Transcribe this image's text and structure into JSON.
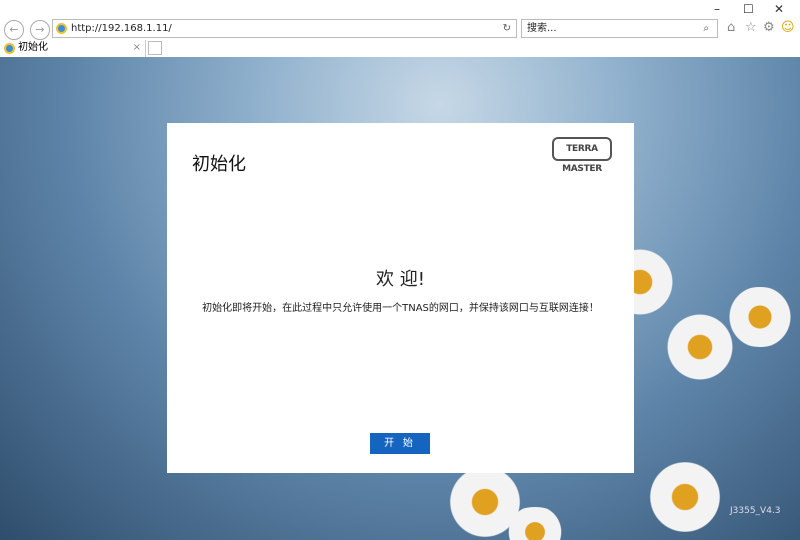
{
  "browser": {
    "url": "http://192.168.1.11/",
    "search_placeholder": "搜索...",
    "tab_title": "初始化",
    "tab_close": "×",
    "minimize": "–",
    "maximize": "☐",
    "close": "✕",
    "back": "←",
    "forward": "→",
    "refresh": "↻",
    "search_btn": "⌕",
    "home": "⌂",
    "favorites": "☆",
    "settings": "⚙",
    "feedback": "☺"
  },
  "dialog": {
    "title": "初始化",
    "logo": "TERRA MASTER",
    "welcome": "欢 迎!",
    "message": "初始化即将开始，在此过程中只允许使用一个TNAS的网口，并保持该网口与互联网连接！",
    "start_button": "开 始"
  },
  "version": "J3355_V4.3"
}
